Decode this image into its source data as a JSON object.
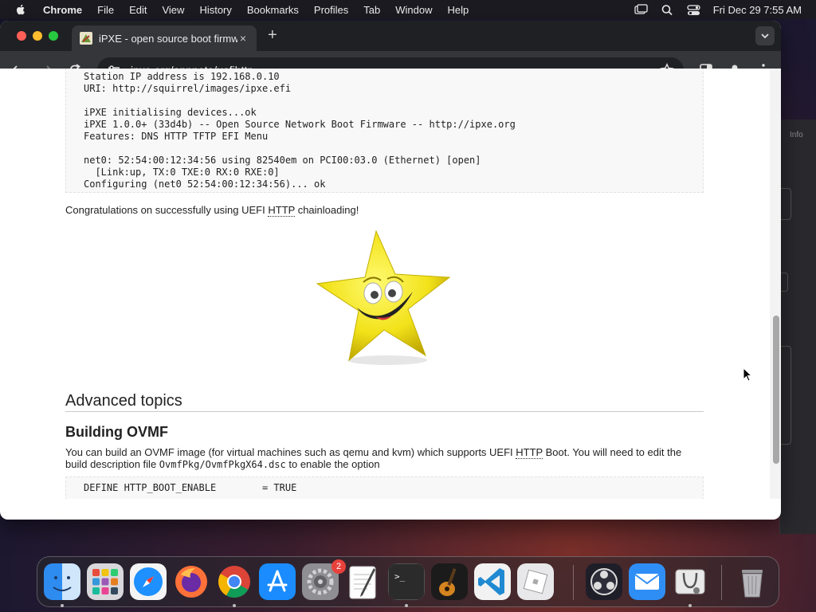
{
  "menubar": {
    "app_name": "Chrome",
    "items": [
      "File",
      "Edit",
      "View",
      "History",
      "Bookmarks",
      "Profiles",
      "Tab",
      "Window",
      "Help"
    ],
    "datetime": "Fri Dec 29  7:55 AM"
  },
  "background_window": {
    "info_label": "Info"
  },
  "browser": {
    "tab_title": "iPXE - open source boot firmware",
    "tab_close": "×",
    "new_tab": "+",
    "url": "ipxe.org/appnote/uefihttp"
  },
  "page": {
    "code_top": "Station IP address is 192.168.0.10\nURI: http://squirrel/images/ipxe.efi\n\niPXE initialising devices...ok\niPXE 1.0.0+ (33d4b) -- Open Source Network Boot Firmware -- http://ipxe.org\nFeatures: DNS HTTP TFTP EFI Menu\n\nnet0: 52:54:00:12:34:56 using 82540em on PCI00:03.0 (Ethernet) [open]\n  [Link:up, TX:0 TXE:0 RX:0 RXE:0]\nConfiguring (net0 52:54:00:12:34:56)... ok",
    "congrats_before": "Congratulations on successfully using UEFI ",
    "congrats_abbr": "HTTP",
    "congrats_after": " chainloading!",
    "section_heading": "Advanced topics",
    "subsection_heading": "Building OVMF",
    "para_part1": "You can build an OVMF image (for virtual machines such as qemu and kvm) which supports UEFI ",
    "para_abbr": "HTTP",
    "para_part2": " Boot. You will need to edit the build description file ",
    "para_code": "OvmfPkg/OvmfPkgX64.dsc",
    "para_part3": " to enable the option",
    "code_bottom": "DEFINE HTTP_BOOT_ENABLE        = TRUE"
  },
  "dock": {
    "apps": [
      "finder-icon",
      "launchpad-icon",
      "safari-icon",
      "firefox-icon",
      "chrome-icon",
      "app-store-icon",
      "system-settings-icon",
      "textedit-icon",
      "terminal-icon",
      "garageband-icon",
      "vscode-icon",
      "roblox-icon",
      "obs-icon",
      "mail-icon",
      "disk-utility-icon",
      "trash-icon"
    ],
    "settings_badge": "2"
  },
  "colors": {
    "menubar": "#1c1b22",
    "tabstrip": "#1f2023",
    "toolbar": "#35363a",
    "omnibox": "#202124"
  }
}
